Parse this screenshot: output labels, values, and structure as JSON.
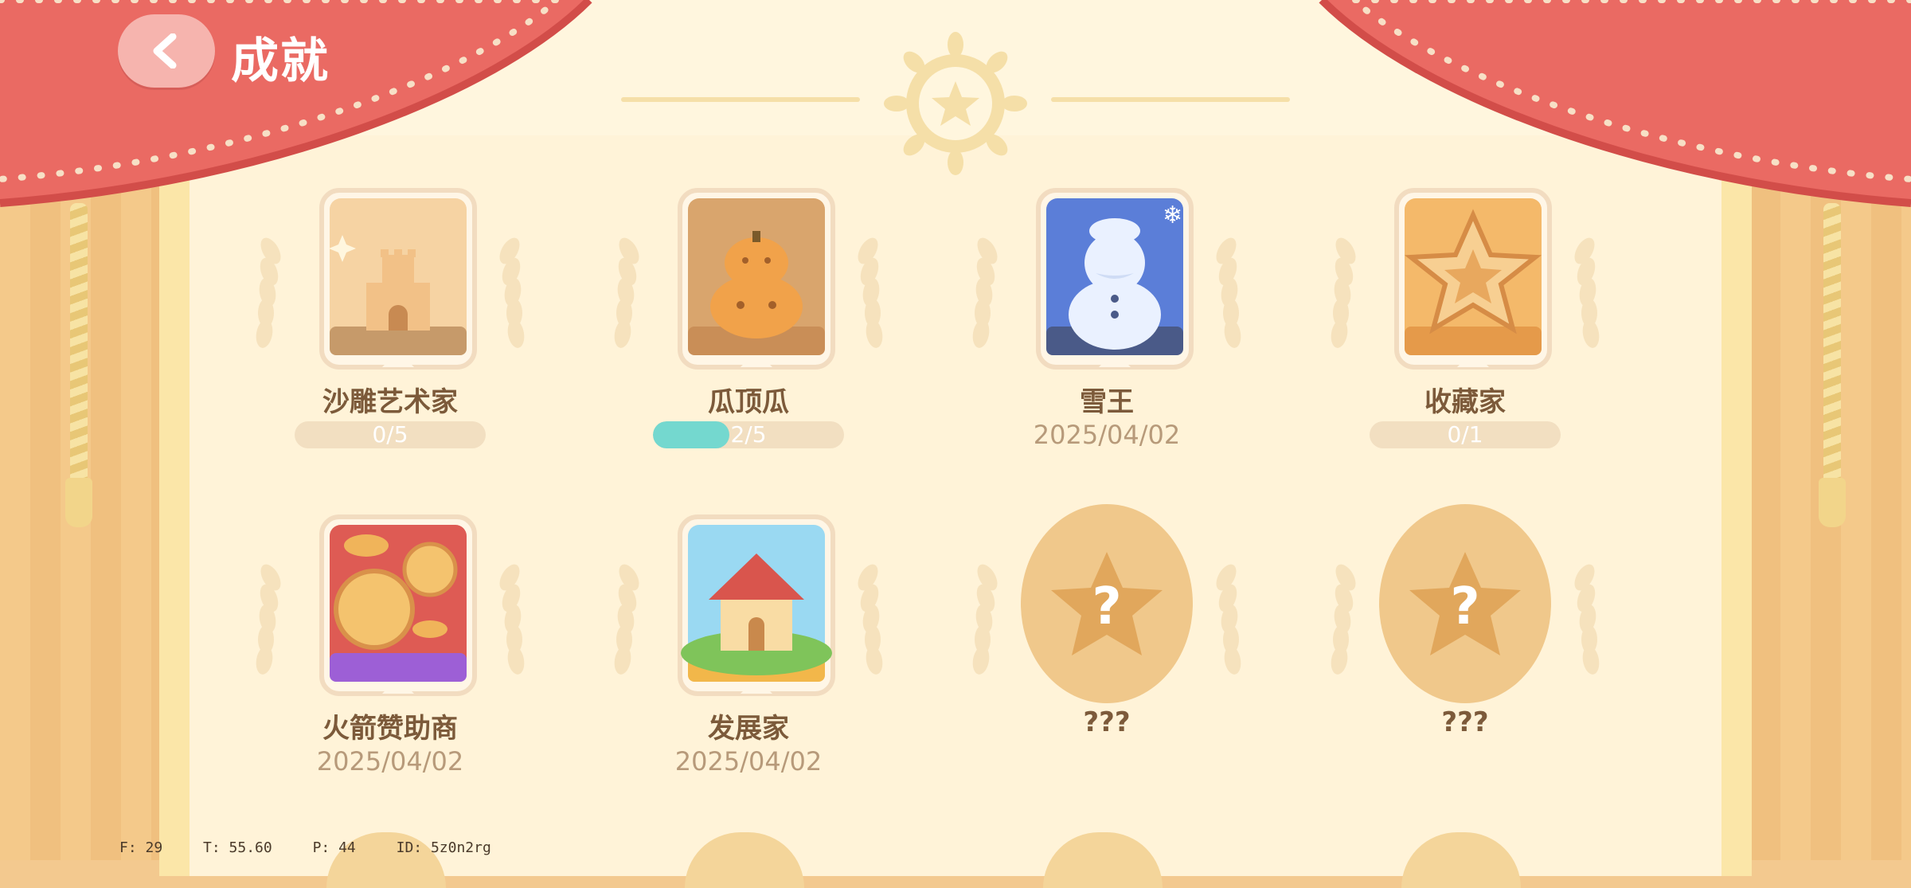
{
  "header": {
    "title": "成就"
  },
  "achievements": [
    {
      "name": "沙雕艺术家",
      "progress_text": "0/5",
      "progress": 0.0,
      "icon": "sandcastle-icon",
      "unlocked": false
    },
    {
      "name": "瓜顶瓜",
      "progress_text": "2/5",
      "progress": 0.4,
      "icon": "pumpkin-stack-icon",
      "unlocked": false
    },
    {
      "name": "雪王",
      "date": "2025/04/02",
      "icon": "snowman-icon",
      "unlocked": true
    },
    {
      "name": "收藏家",
      "progress_text": "0/1",
      "progress": 0.0,
      "icon": "star-icon",
      "unlocked": false
    },
    {
      "name": "火箭赞助商",
      "date": "2025/04/02",
      "icon": "coins-icon",
      "unlocked": true
    },
    {
      "name": "发展家",
      "date": "2025/04/02",
      "icon": "house-icon",
      "unlocked": true
    },
    {
      "name": "???",
      "icon": "mystery-star-icon",
      "unlocked": false
    },
    {
      "name": "???",
      "icon": "mystery-star-icon",
      "unlocked": false
    }
  ],
  "debug": {
    "f": "F: 29",
    "t": "T: 55.60",
    "p": "P: 44",
    "id": "ID: 5z0n2rg"
  },
  "colors": {
    "curtain": "#ea6a63",
    "progress": "#74d8cf",
    "accent": "#f0c88b"
  }
}
